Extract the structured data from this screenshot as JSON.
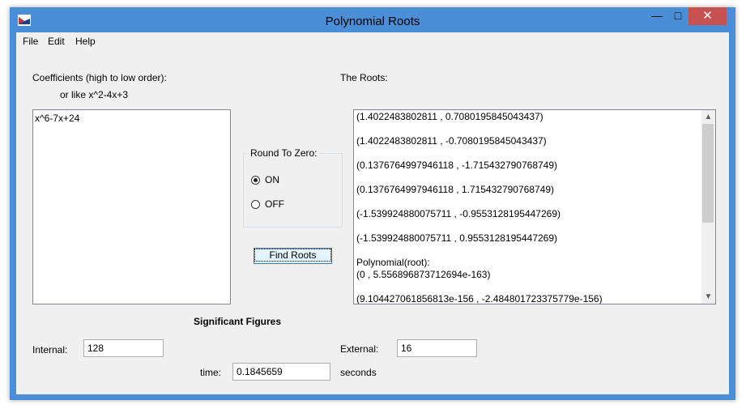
{
  "window": {
    "title": "Polynomial Roots",
    "minimize_glyph": "—",
    "maximize_glyph": "□",
    "close_glyph": "✕"
  },
  "menu": {
    "file": "File",
    "edit": "Edit",
    "help": "Help"
  },
  "coefficients": {
    "label": "Coefficients (high to low order):",
    "hint": "or like x^2-4x+3",
    "value": "x^6-7x+24"
  },
  "round_to_zero": {
    "title": "Round To Zero:",
    "on_label": "ON",
    "off_label": "OFF",
    "selected": "ON"
  },
  "find_roots_button": "Find Roots",
  "roots": {
    "label": "The Roots:",
    "lines": [
      "(1.4022483802811 , 0.7080195845043437)",
      "(1.4022483802811 , -0.7080195845043437)",
      "(0.1376764997946118 , -1.715432790768749)",
      "(0.1376764997946118 , 1.715432790768749)",
      "(-1.539924880075711 , -0.9553128195447269)",
      "(-1.539924880075711 , 0.9553128195447269)"
    ],
    "polynomial_label": "Polynomial(root):",
    "polynomial_lines": [
      "(0 , 5.556896873712694e-163)",
      "",
      "(9.104427061856813e-156 , -2.484801723375779e-156)"
    ]
  },
  "significant_figures": {
    "title": "Significant Figures",
    "internal_label": "Internal:",
    "internal_value": "128",
    "external_label": "External:",
    "external_value": "16"
  },
  "time": {
    "label": "time:",
    "value": "0.1845659",
    "unit": "seconds"
  }
}
